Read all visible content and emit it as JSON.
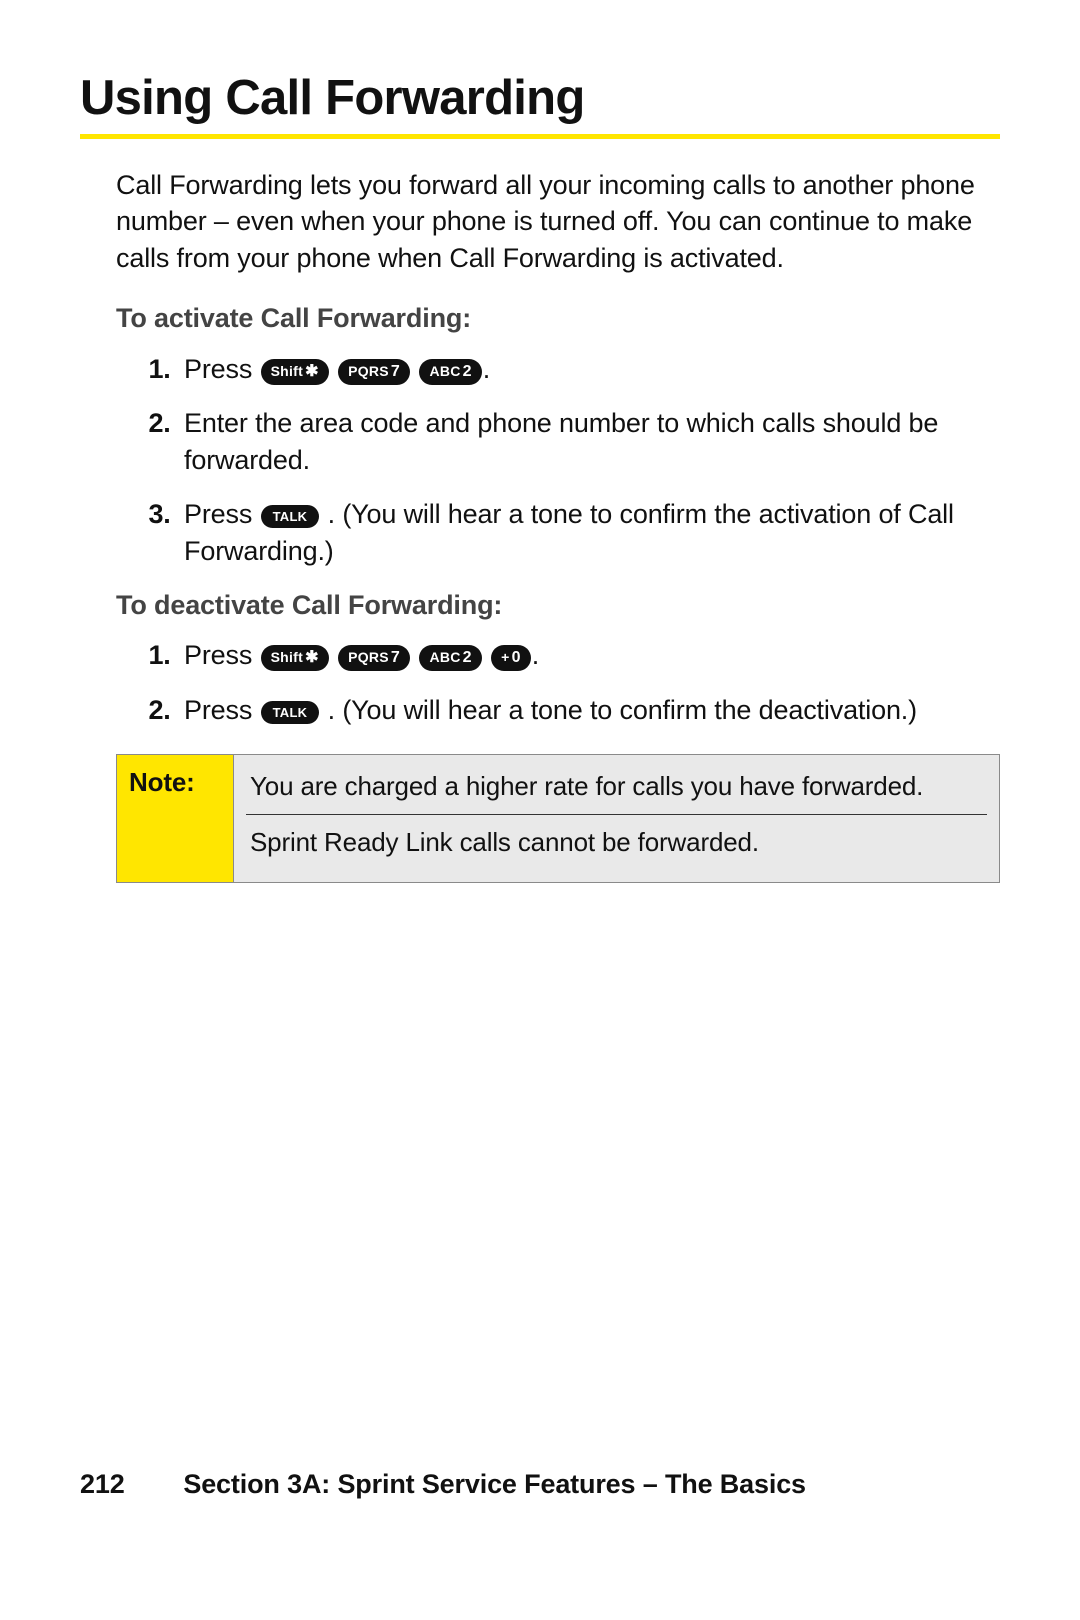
{
  "title": "Using Call Forwarding",
  "intro": "Call Forwarding lets you forward all your incoming calls to another phone number – even when your phone is turned off. You can continue to make calls from your phone when Call Forwarding is activated.",
  "activate": {
    "heading": "To activate Call Forwarding:",
    "steps": {
      "s1_press": "Press",
      "s1_period": ".",
      "s2": "Enter the area code and phone number to which calls should be forwarded.",
      "s3_press": "Press",
      "s3_rest": ". (You will hear a tone to confirm the activation of Call Forwarding.)"
    }
  },
  "deactivate": {
    "heading": "To deactivate Call Forwarding:",
    "steps": {
      "s1_press": "Press",
      "s1_period": ".",
      "s2_press": "Press",
      "s2_rest": ". (You will hear a tone to confirm the deactivation.)"
    }
  },
  "keys": {
    "shift_star_label": "Shift",
    "shift_star_sym": "✱",
    "pqrs7_label": "PQRS",
    "pqrs7_num": "7",
    "abc2_label": "ABC",
    "abc2_num": "2",
    "plus0_label": "+",
    "plus0_num": "0",
    "talk_label": "TALK"
  },
  "note": {
    "label": "Note:",
    "line1": "You are charged a higher rate for calls you have forwarded.",
    "line2": "Sprint Ready Link calls cannot be forwarded."
  },
  "footer": {
    "page": "212",
    "section": "Section 3A: Sprint Service Features – The Basics"
  }
}
